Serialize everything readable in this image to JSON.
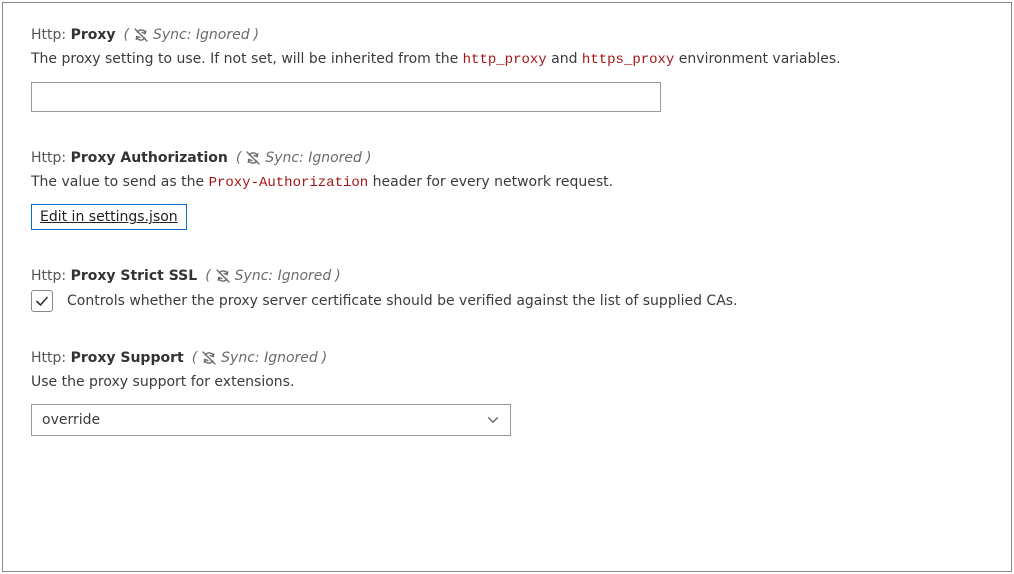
{
  "sync_label": "Sync: Ignored",
  "settings": {
    "proxy": {
      "scope": "Http:",
      "name": "Proxy",
      "desc_pre": "The proxy setting to use. If not set, will be inherited from the ",
      "code1": "http_proxy",
      "desc_mid": " and ",
      "code2": "https_proxy",
      "desc_post": " environment variables.",
      "value": ""
    },
    "proxy_auth": {
      "scope": "Http:",
      "name": "Proxy Authorization",
      "desc_pre": "The value to send as the ",
      "code1": "Proxy-Authorization",
      "desc_post": " header for every network request.",
      "link_label": "Edit in settings.json"
    },
    "proxy_strict": {
      "scope": "Http:",
      "name": "Proxy Strict SSL",
      "desc": "Controls whether the proxy server certificate should be verified against the list of supplied CAs.",
      "checked": true
    },
    "proxy_support": {
      "scope": "Http:",
      "name": "Proxy Support",
      "desc": "Use the proxy support for extensions.",
      "selected": "override"
    }
  }
}
